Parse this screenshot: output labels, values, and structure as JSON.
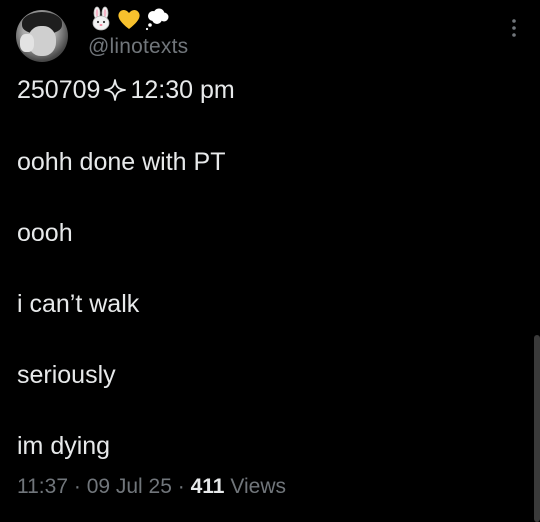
{
  "author": {
    "handle": "@linotexts",
    "name_emojis": [
      "rabbit-face-emoji",
      "yellow-heart-emoji",
      "thought-balloon-emoji"
    ]
  },
  "tweet": {
    "date_code": "250709",
    "separator_icon": "sparkle-icon",
    "time_label": "12:30 pm",
    "lines": [
      "oohh done with PT",
      "oooh",
      "i can’t walk",
      "seriously",
      "im dying"
    ]
  },
  "meta": {
    "time": "11:37",
    "dot1": "·",
    "date": "09 Jul 25",
    "dot2": "·",
    "views_count": "411",
    "views_label": "Views"
  },
  "colors": {
    "background": "#000000",
    "text_primary": "#e7e9ea",
    "text_secondary": "#71767b",
    "heart": "#f7c12d"
  }
}
